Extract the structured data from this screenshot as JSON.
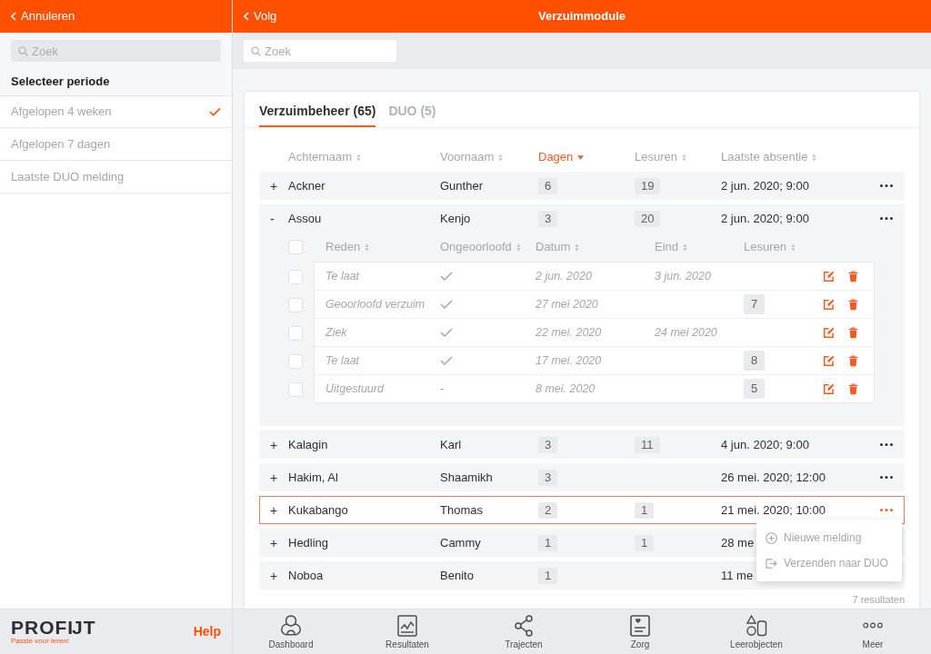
{
  "left_panel": {
    "back_label": "Annuleren",
    "search": {
      "placeholder": "Zoek"
    },
    "section_title": "Selecteer periode",
    "periods": [
      {
        "label": "Afgelopen 4 weken",
        "selected": true
      },
      {
        "label": "Afgelopen 7 dagen",
        "selected": false
      },
      {
        "label": "Laatste DUO melding",
        "selected": false
      }
    ]
  },
  "header": {
    "back_label": "Volg",
    "title": "Verzuimmodule"
  },
  "search": {
    "placeholder": "Zoek"
  },
  "tabs": [
    {
      "label": "Verzuimbeheer (65)",
      "selected": true
    },
    {
      "label": "DUO (5)",
      "selected": false
    }
  ],
  "table": {
    "columns": [
      {
        "label": "Achternaam",
        "sorted": false
      },
      {
        "label": "Voornaam",
        "sorted": false
      },
      {
        "label": "Dagen",
        "sorted": true
      },
      {
        "label": "Lesuren",
        "sorted": false
      },
      {
        "label": "Laatste absentie",
        "sorted": false
      }
    ],
    "detail_columns": [
      {
        "label": "Reden",
        "sorted": false
      },
      {
        "label": "Ongeoorloofd",
        "sorted": false
      },
      {
        "label": "Datum",
        "sorted": false
      },
      {
        "label": "Eind",
        "sorted": false
      },
      {
        "label": "Lesuren",
        "sorted": false
      }
    ],
    "rows": [
      {
        "toggle": "+",
        "expanded": false,
        "selected": false,
        "menu_open": false,
        "menu_button": true,
        "last_name": "Ackner",
        "first_name": "Gunther",
        "days": "6",
        "lessons": "19",
        "last_absence": "2 jun. 2020; 9:00"
      },
      {
        "toggle": "-",
        "expanded": true,
        "selected": false,
        "menu_open": false,
        "menu_button": true,
        "last_name": "Assou",
        "first_name": "Kenjo",
        "days": "3",
        "lessons": "20",
        "last_absence": "2 jun. 2020; 9:00",
        "details": {
          "select_all_checked": false,
          "rows": [
            {
              "checked": false,
              "reason": "Te laat",
              "unauthorized": true,
              "date": "2 jun. 2020",
              "end": "3 jun. 2020"
            },
            {
              "checked": false,
              "reason": "Geoorloofd verzuim",
              "unauthorized": true,
              "date": "27 mei 2020",
              "lessons": "7"
            },
            {
              "checked": false,
              "reason": "Ziek",
              "unauthorized": true,
              "date": "22 mei. 2020",
              "end": "24 mei 2020"
            },
            {
              "checked": false,
              "reason": "Te laat",
              "unauthorized": true,
              "date": "17 mei. 2020",
              "lessons": "8"
            },
            {
              "checked": false,
              "reason": "Uitgestuurd",
              "unauthorized": false,
              "empty_mark": "-",
              "date": "8 mei. 2020",
              "lessons": "5"
            }
          ]
        }
      },
      {
        "toggle": "+",
        "expanded": false,
        "selected": false,
        "menu_open": false,
        "menu_button": true,
        "last_name": "Kalagin",
        "first_name": "Karl",
        "days": "3",
        "lessons": "11",
        "last_absence": "4 jun. 2020; 9:00"
      },
      {
        "toggle": "+",
        "expanded": false,
        "selected": false,
        "menu_open": false,
        "menu_button": true,
        "last_name": "Hakim, Al",
        "first_name": "Shaamikh",
        "days": "3",
        "last_absence": "26 mei. 2020; 12:00"
      },
      {
        "toggle": "+",
        "expanded": false,
        "selected": true,
        "menu_open": true,
        "menu_button": true,
        "last_name": "Kukabango",
        "first_name": "Thomas",
        "days": "2",
        "lessons": "1",
        "last_absence": "21 mei. 2020; 10:00"
      },
      {
        "toggle": "+",
        "expanded": false,
        "selected": false,
        "menu_open": false,
        "menu_button": false,
        "last_name": "Hedling",
        "first_name": "Cammy",
        "days": "1",
        "lessons": "1",
        "last_absence": "28 me"
      },
      {
        "toggle": "+",
        "expanded": false,
        "selected": false,
        "menu_open": false,
        "menu_button": false,
        "last_name": "Noboa",
        "first_name": "Benito",
        "days": "1",
        "last_absence": "11 me"
      }
    ],
    "results_count": "7 resultaten"
  },
  "row_menu": [
    {
      "kind": "new",
      "label": "Nieuwe melding"
    },
    {
      "kind": "send",
      "label": "Verzenden naar DUO"
    }
  ],
  "bottom_bar": {
    "brand": {
      "name": "PROFĲT",
      "tagline": "Passie voor leren!"
    },
    "help": "Help",
    "nav": [
      {
        "kind": "dashboard",
        "label": "Dashboard"
      },
      {
        "kind": "results",
        "label": "Resultaten"
      },
      {
        "kind": "tracks",
        "label": "Trajecten"
      },
      {
        "kind": "care",
        "label": "Zorg"
      },
      {
        "kind": "learning",
        "label": "Leerobjecten"
      },
      {
        "kind": "more",
        "label": "Meer"
      }
    ]
  }
}
